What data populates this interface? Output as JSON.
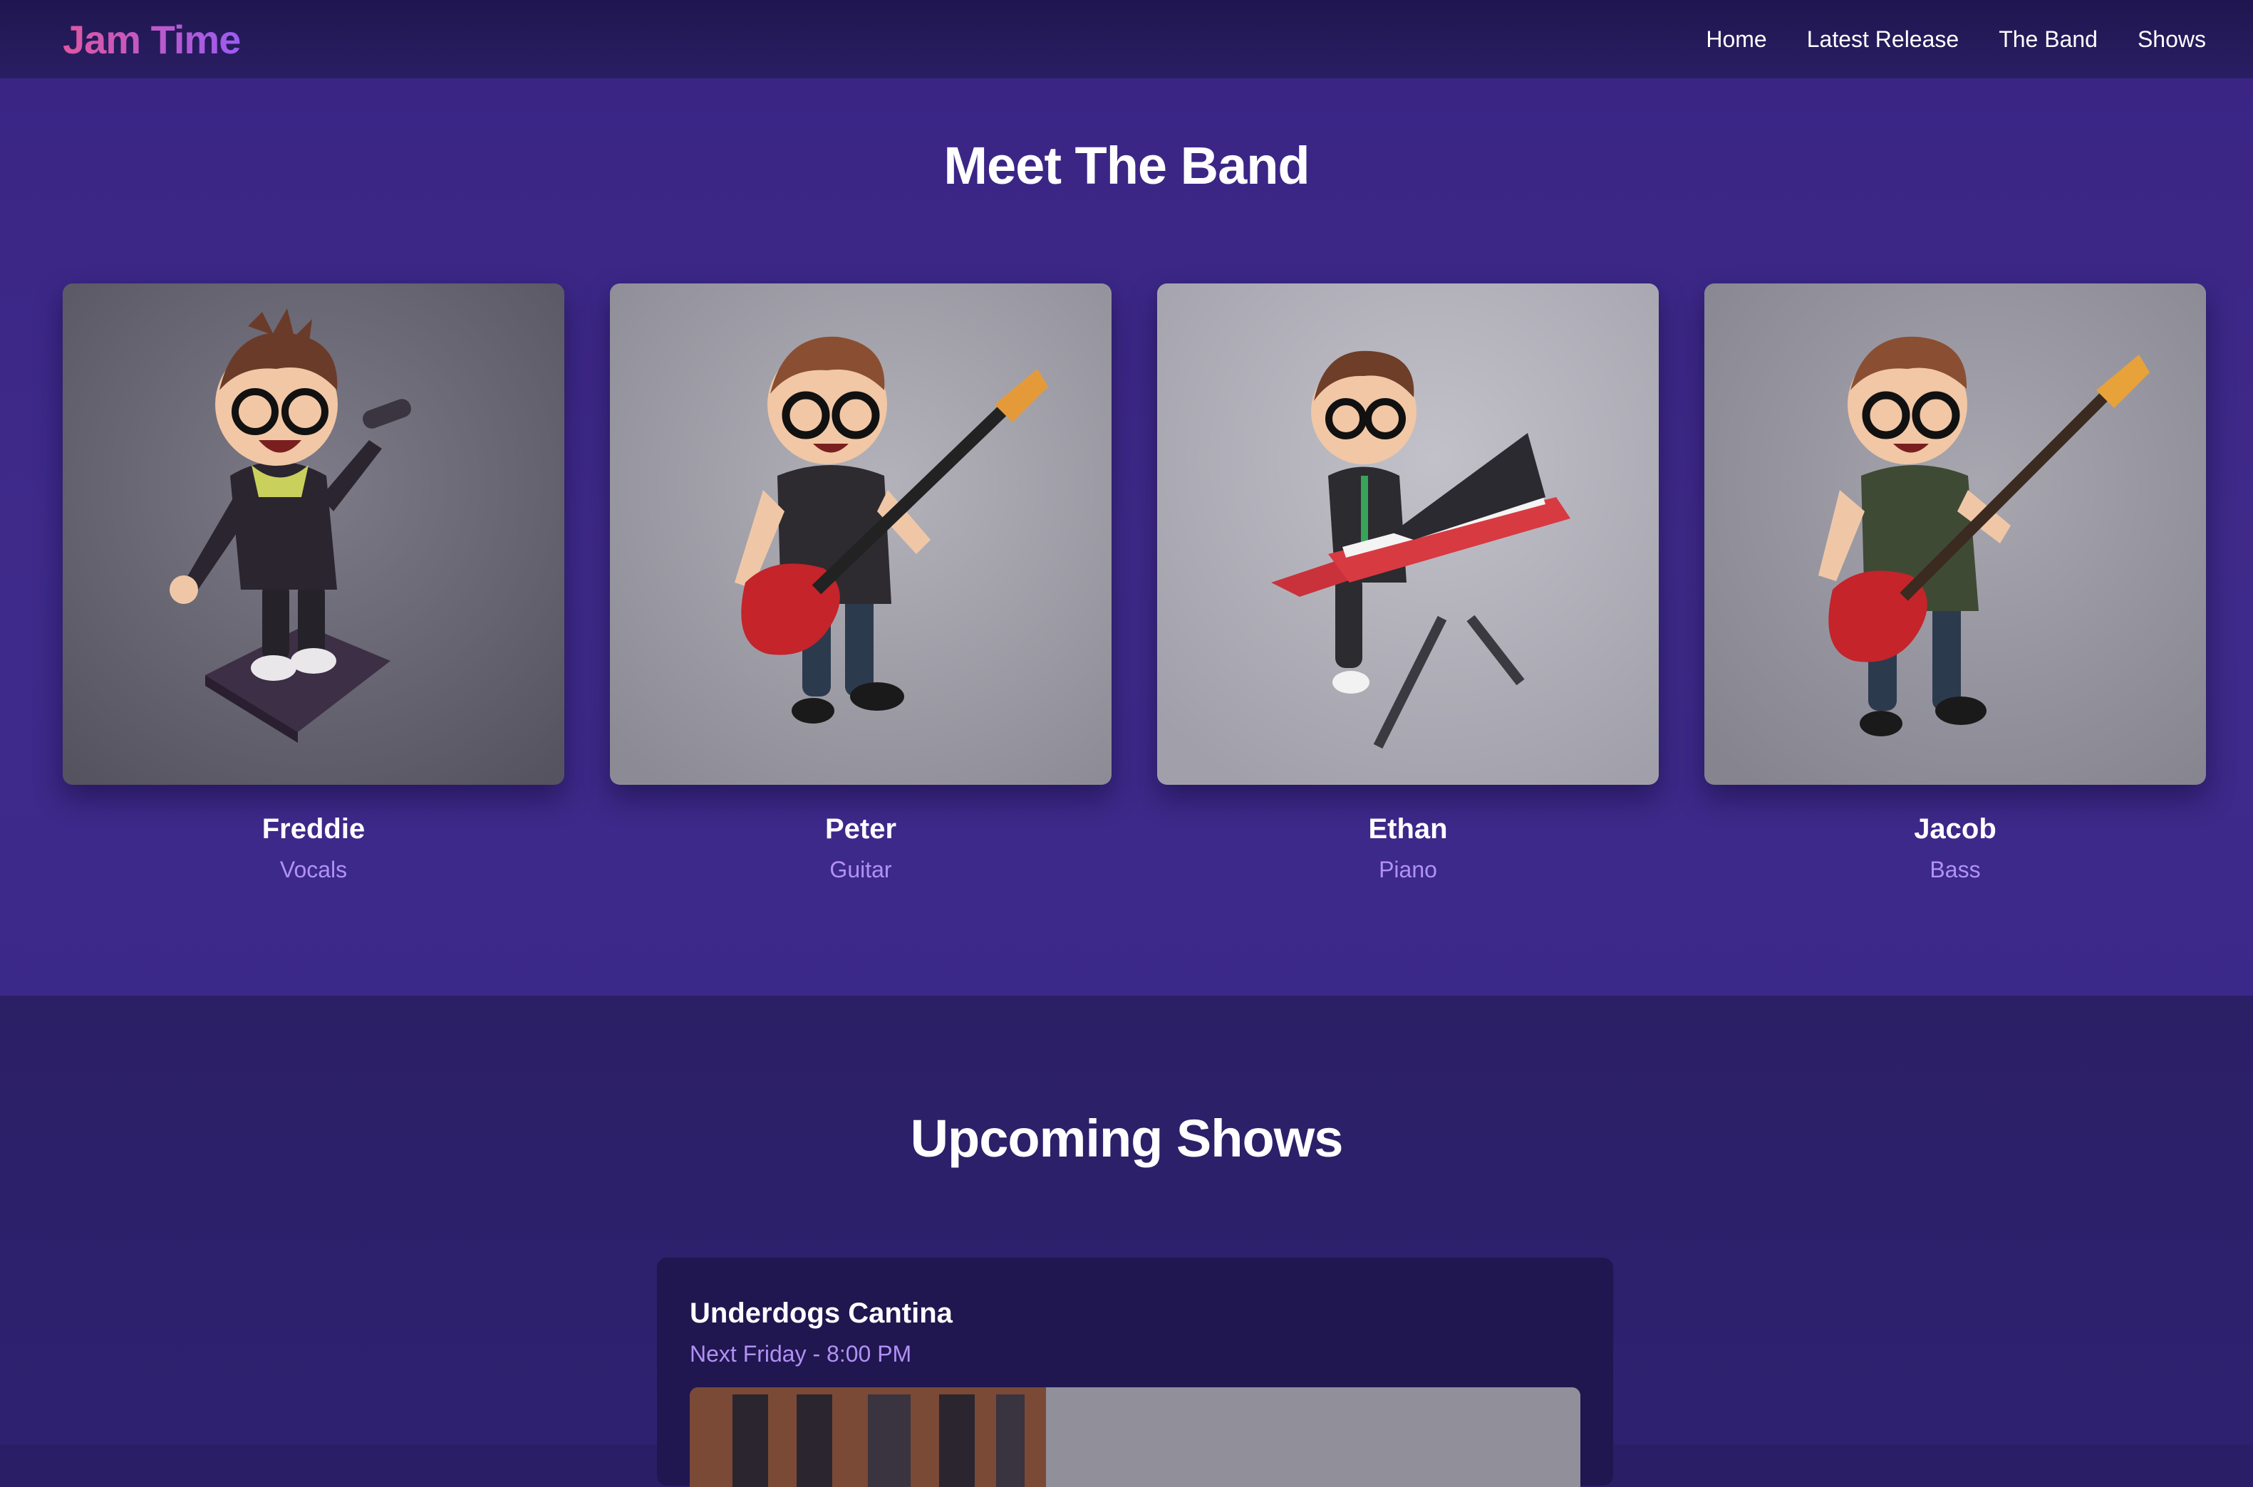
{
  "brand": {
    "name": "Jam Time"
  },
  "nav": {
    "links": [
      "Home",
      "Latest Release",
      "The Band",
      "Shows"
    ]
  },
  "band": {
    "title": "Meet The Band",
    "members": [
      {
        "name": "Freddie",
        "role": "Vocals",
        "instrument": "microphone-icon"
      },
      {
        "name": "Peter",
        "role": "Guitar",
        "instrument": "guitar-icon"
      },
      {
        "name": "Ethan",
        "role": "Piano",
        "instrument": "keyboard-icon"
      },
      {
        "name": "Jacob",
        "role": "Bass",
        "instrument": "bass-icon"
      }
    ]
  },
  "shows": {
    "title": "Upcoming Shows",
    "items": [
      {
        "venue": "Underdogs Cantina",
        "time": "Next Friday - 8:00 PM"
      }
    ]
  },
  "colors": {
    "accent": "#b191f5",
    "logo_start": "#e0579f",
    "logo_end": "#9b5cf0"
  }
}
